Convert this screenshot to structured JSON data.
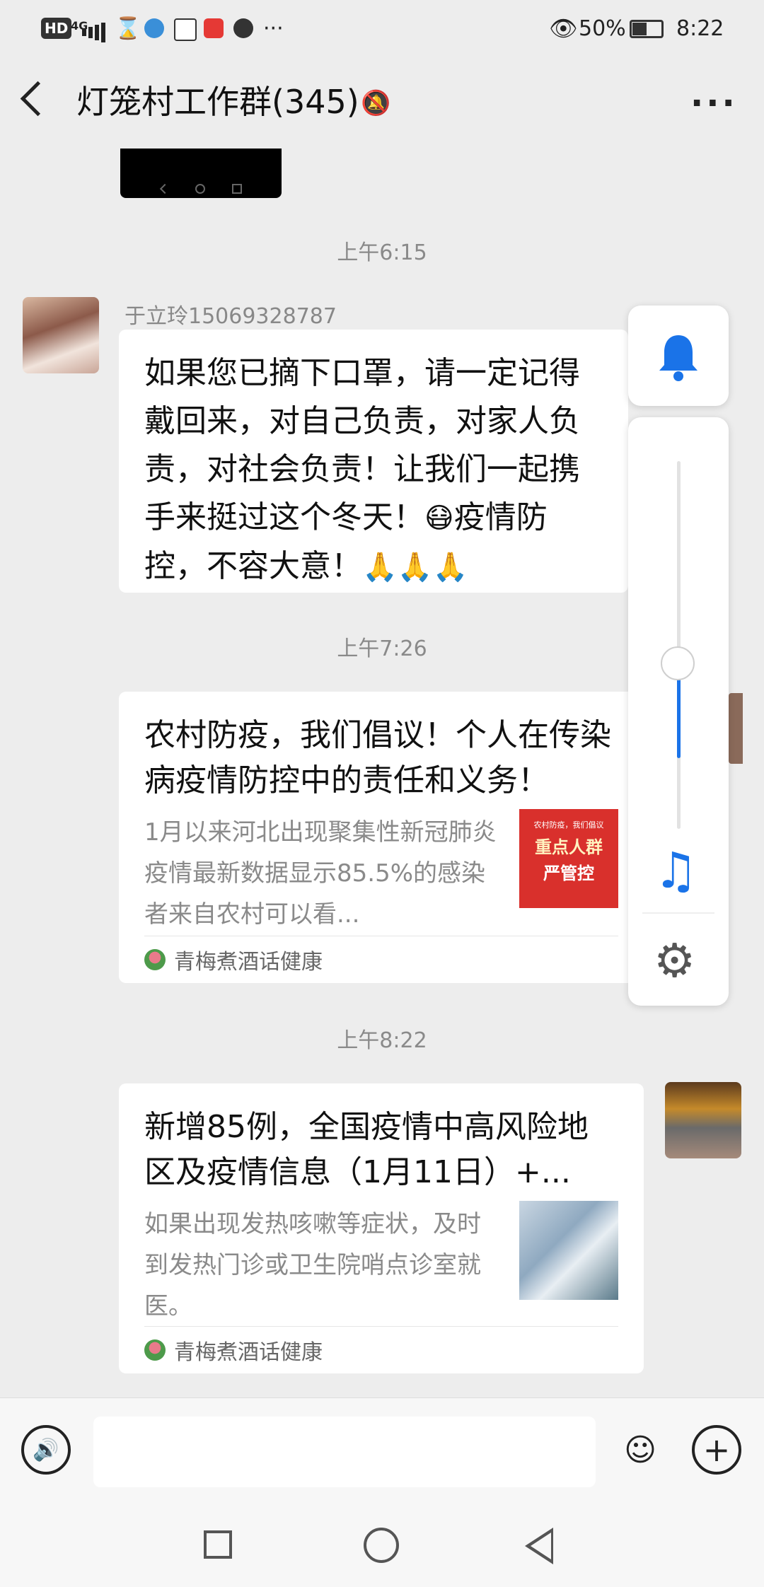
{
  "status_bar": {
    "hd": "HD",
    "network": "4G",
    "battery": "50%",
    "time": "8:22"
  },
  "header": {
    "title": "灯笼村工作群(345)"
  },
  "timestamps": {
    "t1": "上午6:15",
    "t2": "上午7:26",
    "t3": "上午8:22"
  },
  "message1": {
    "sender": "于立玲15069328787",
    "text_a": "如果您已摘下口罩，请一定记得戴回来，对自己负责，对家人负责，对社会负责！让我们一起携手来挺过这个冬天！",
    "emoji_mask": "😷",
    "text_b": "疫情防控，不容大意！",
    "emoji_pray": "🙏🙏🙏"
  },
  "card1": {
    "title": "农村防疫，我们倡议！个人在传染病疫情防控中的责任和义务！",
    "desc": "1月以来河北出现聚集性新冠肺炎疫情最新数据显示85.5%的感染者来自农村可以看...",
    "source": "青梅煮酒话健康",
    "thumb_text1": "农村防疫，我们倡议",
    "thumb_text2": "重点人群",
    "thumb_text3": "严管控"
  },
  "card2": {
    "title": "新增85例，全国疫情中高风险地区及疫情信息（1月11日）+...",
    "desc": "如果出现发热咳嗽等症状，及时到发热门诊或卫生院哨点诊室就医。",
    "source": "青梅煮酒话健康"
  },
  "volume_panel": {
    "level": 0.45,
    "accent": "#1a73e8"
  },
  "colors": {
    "background": "#ededed",
    "bubble": "#ffffff",
    "accent": "#1a73e8"
  }
}
